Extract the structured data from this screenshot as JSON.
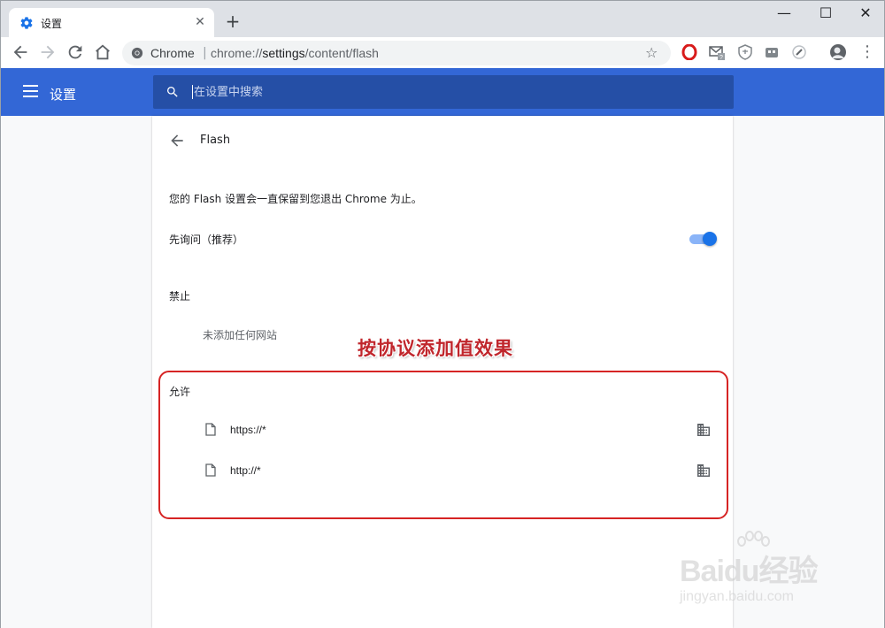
{
  "browser": {
    "tab": {
      "title": "设置",
      "icon": "gear-icon"
    },
    "new_tab_label": "+",
    "window_controls": {
      "minimize": "—",
      "maximize": "☐",
      "close": "✕"
    },
    "omnibox": {
      "site_label": "Chrome",
      "separator": "|",
      "url_prefix": "chrome://",
      "url_host": "settings",
      "url_path": "/content/flash"
    },
    "extensions": [
      "opera-icon",
      "gmail-checker-icon",
      "shield-icon",
      "gamepad-icon",
      "speed-dial-icon",
      "profile-avatar-icon"
    ]
  },
  "header": {
    "title": "设置",
    "search_placeholder": "在设置中搜索"
  },
  "page": {
    "title": "Flash",
    "description": "您的 Flash 设置会一直保留到您退出 Chrome 为止。",
    "ask_first": {
      "label": "先询问（推荐）",
      "enabled": true
    },
    "block": {
      "label": "禁止",
      "empty_message": "未添加任何网站"
    },
    "allow": {
      "label": "允许",
      "sites": [
        {
          "url": "https://*"
        },
        {
          "url": "http://*"
        }
      ]
    }
  },
  "annotation": {
    "text": "按协议添加值效果",
    "color": "#c0262c"
  },
  "watermark": {
    "brand": "Baidu经验",
    "sub": "jingyan.baidu.com"
  },
  "colors": {
    "accent": "#3367d6",
    "search_bg": "#254fa6",
    "toggle_on": "#1a73e8"
  }
}
